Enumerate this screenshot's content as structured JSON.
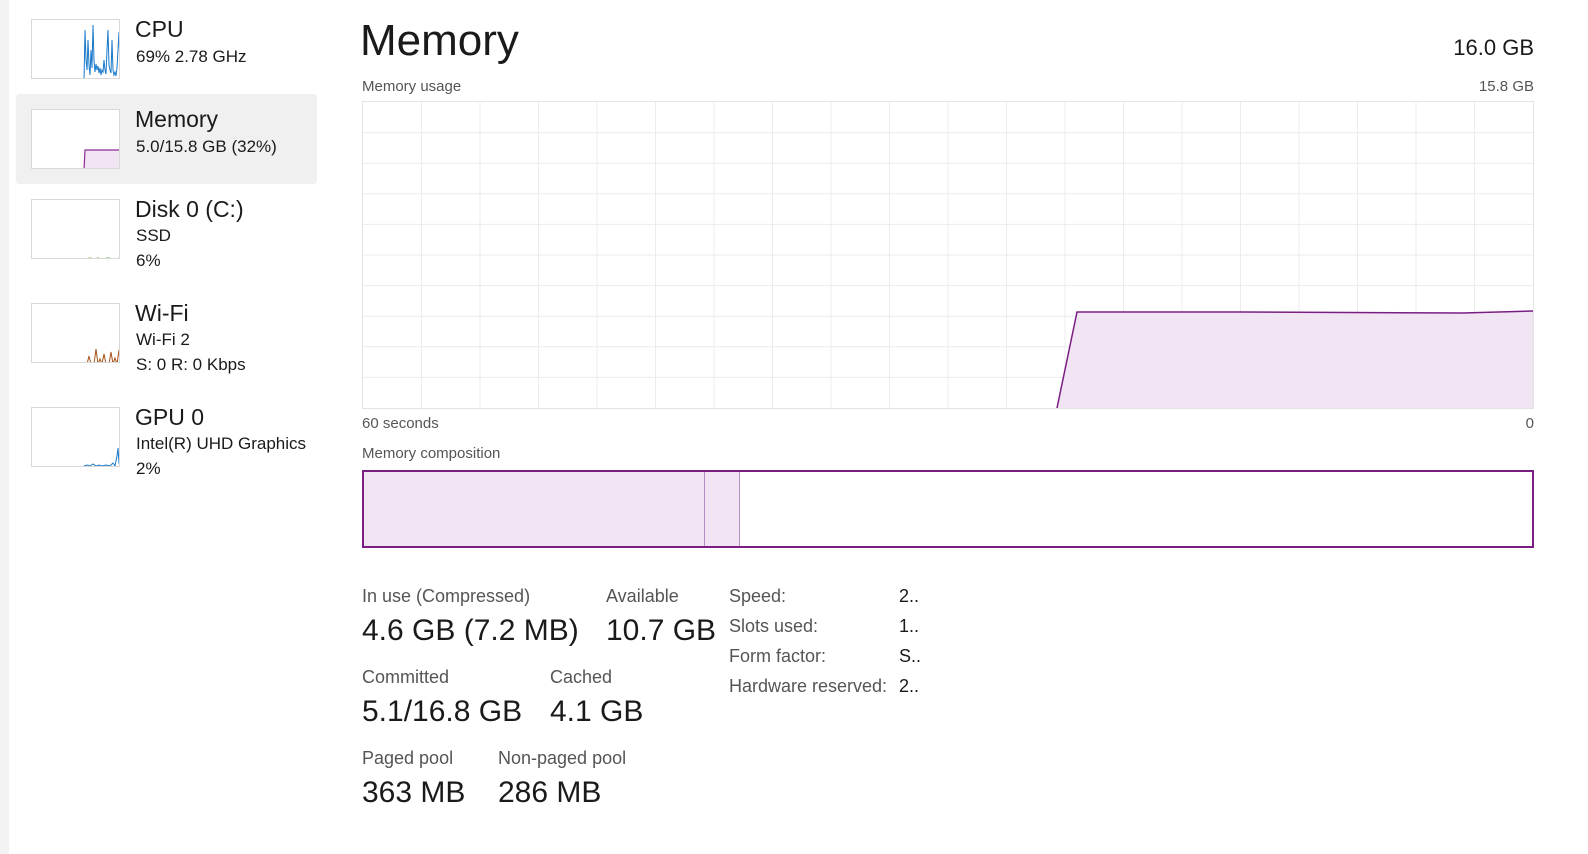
{
  "sidebar": {
    "items": [
      {
        "name": "CPU",
        "line1": "69%  2.78 GHz",
        "line2": "",
        "color": "#1979ca"
      },
      {
        "name": "Memory",
        "line1": "5.0/15.8 GB (32%)",
        "line2": "",
        "color": "#8b2a94",
        "selected": true
      },
      {
        "name": "Disk 0 (C:)",
        "line1": "SSD",
        "line2": "6%",
        "color": "#4c9a2a"
      },
      {
        "name": "Wi-Fi",
        "line1": "Wi-Fi 2",
        "line2": "S: 0  R: 0 Kbps",
        "color": "#a7541a"
      },
      {
        "name": "GPU 0",
        "line1": "Intel(R) UHD Graphics",
        "line2": "2%",
        "color": "#1979ca"
      }
    ]
  },
  "main": {
    "title": "Memory",
    "total": "16.0 GB",
    "usage_label": "Memory usage",
    "usage_max": "15.8 GB",
    "time_left": "60 seconds",
    "time_right": "0",
    "composition_label": "Memory composition",
    "composition": {
      "in_use_fraction": 0.292,
      "modified_fraction": 0.03
    },
    "stats": {
      "in_use_label": "In use (Compressed)",
      "in_use_value": "4.6 GB (7.2 MB)",
      "available_label": "Available",
      "available_value": "10.7 GB",
      "committed_label": "Committed",
      "committed_value": "5.1/16.8 GB",
      "cached_label": "Cached",
      "cached_value": "4.1 GB",
      "paged_label": "Paged pool",
      "paged_value": "363 MB",
      "nonpaged_label": "Non-paged pool",
      "nonpaged_value": "286 MB"
    },
    "details": [
      {
        "key": "Speed:",
        "value": "2.."
      },
      {
        "key": "Slots used:",
        "value": "1.."
      },
      {
        "key": "Form factor:",
        "value": "S.."
      },
      {
        "key": "Hardware reserved:",
        "value": "2.."
      }
    ]
  },
  "colors": {
    "accent": "#7b1e84",
    "fill": "#f1e5f3"
  }
}
